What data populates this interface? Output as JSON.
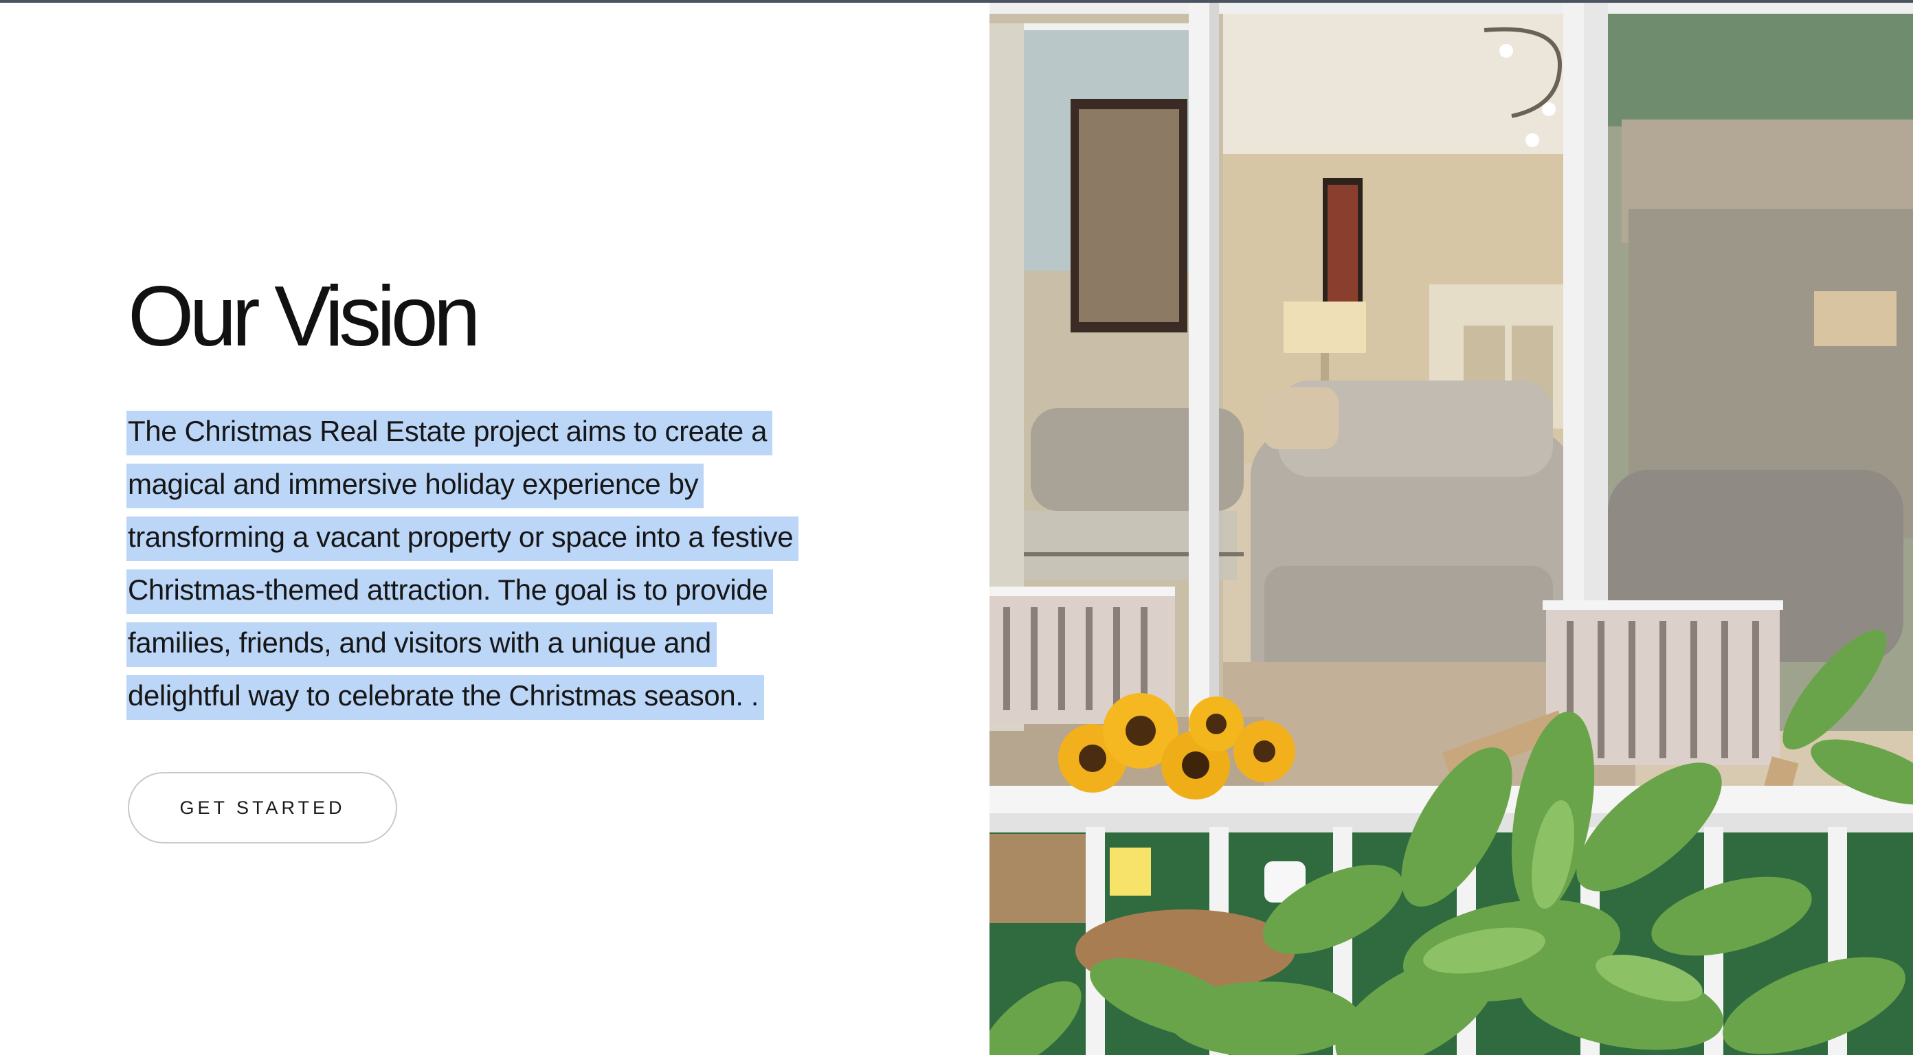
{
  "section": {
    "title": "Our Vision",
    "body_lines": [
      "The Christmas Real Estate project aims to create a",
      "magical and immersive holiday experience by",
      "transforming a vacant property or space into a festive",
      "Christmas-themed attraction. The goal is to provide",
      "families, friends, and visitors with a unique and",
      "delightful way to celebrate the Christmas season. ."
    ],
    "cta_label": "GET STARTED"
  },
  "photo": {
    "subject": "patio-living-room-photo"
  },
  "colors": {
    "selection_highlight": "#bcd6f8",
    "top_border": "#4a5360",
    "text": "#161616"
  }
}
